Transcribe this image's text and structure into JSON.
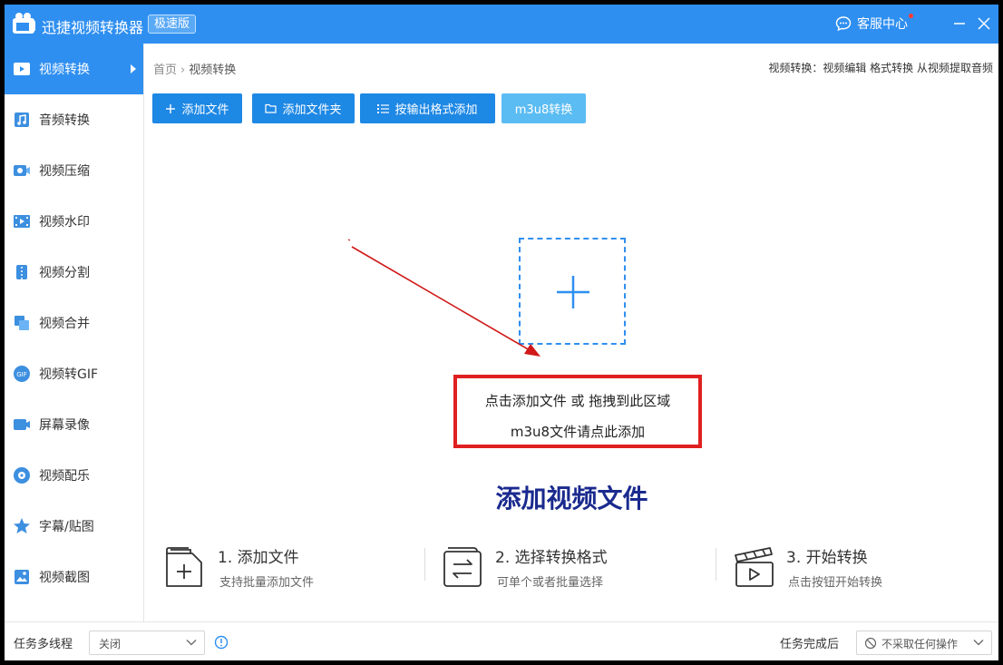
{
  "app": {
    "title": "迅捷视频转换器",
    "edition": "极速版",
    "support_label": "客服中心",
    "colors": {
      "primary": "#2f8ff0",
      "button": "#1e88e5",
      "button_light": "#5bbcf3",
      "highlight_red": "#e02020",
      "title_text": "#1a2a8e"
    }
  },
  "sidebar": {
    "items": [
      {
        "label": "视频转换",
        "icon": "video-convert-icon",
        "active": true
      },
      {
        "label": "音频转换",
        "icon": "audio-convert-icon",
        "active": false
      },
      {
        "label": "视频压缩",
        "icon": "video-compress-icon",
        "active": false
      },
      {
        "label": "视频水印",
        "icon": "video-watermark-icon",
        "active": false
      },
      {
        "label": "视频分割",
        "icon": "video-split-icon",
        "active": false
      },
      {
        "label": "视频合并",
        "icon": "video-merge-icon",
        "active": false
      },
      {
        "label": "视频转GIF",
        "icon": "video-gif-icon",
        "active": false
      },
      {
        "label": "屏幕录像",
        "icon": "screen-record-icon",
        "active": false
      },
      {
        "label": "视频配乐",
        "icon": "video-music-icon",
        "active": false
      },
      {
        "label": "字幕/贴图",
        "icon": "subtitle-sticker-icon",
        "active": false
      },
      {
        "label": "视频截图",
        "icon": "video-screenshot-icon",
        "active": false
      }
    ]
  },
  "breadcrumb": {
    "home": "首页",
    "separator": "›",
    "current": "视频转换"
  },
  "hint": "视频转换：视频编辑 格式转换 从视频提取音频",
  "toolbar": {
    "add_file": "添加文件",
    "add_folder": "添加文件夹",
    "add_by_format": "按输出格式添加",
    "m3u8": "m3u8转换"
  },
  "dropzone": {
    "line1": "点击添加文件 或 拖拽到此区域",
    "line2": "m3u8文件请点此添加",
    "big_title": "添加视频文件"
  },
  "steps": [
    {
      "title": "1. 添加文件",
      "desc": "支持批量添加文件",
      "icon": "add-file-icon"
    },
    {
      "title": "2. 选择转换格式",
      "desc": "可单个或者批量选择",
      "icon": "format-switch-icon"
    },
    {
      "title": "3. 开始转换",
      "desc": "点击按钮开始转换",
      "icon": "clapper-play-icon"
    }
  ],
  "bottom": {
    "thread_label": "任务多线程",
    "thread_value": "关闭",
    "after_label": "任务完成后",
    "after_value": "不采取任何操作"
  }
}
